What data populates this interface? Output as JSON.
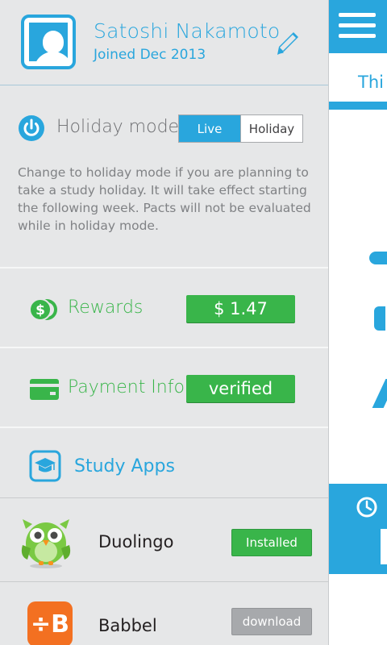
{
  "profile": {
    "name": "Satoshi Nakamoto",
    "joined": "Joined Dec 2013"
  },
  "holiday": {
    "label": "Holiday mode",
    "options": [
      "Live",
      "Holiday"
    ],
    "selected": "Live",
    "description": "Change to holiday mode if you are planning to take a study holiday. It will take effect starting the following week. Pacts will not be evaluated while in holiday mode."
  },
  "rewards": {
    "label": "Rewards",
    "value": "$ 1.47"
  },
  "payment": {
    "label": "Payment Info",
    "value": "verified"
  },
  "study_apps": {
    "label": "Study Apps",
    "apps": [
      {
        "name": "Duolingo",
        "status": "Installed"
      },
      {
        "name": "Babbel",
        "status": "download"
      }
    ]
  },
  "main": {
    "tab_label": "Thi"
  },
  "colors": {
    "accent": "#29a6dd",
    "success": "#39b54a",
    "muted": "#a7a9ac",
    "drawer_bg": "#e6e7e8"
  },
  "icons": [
    "avatar-icon",
    "pencil-icon",
    "power-icon",
    "coins-icon",
    "credit-card-icon",
    "graduation-cap-icon",
    "menu-icon",
    "clock-icon"
  ]
}
